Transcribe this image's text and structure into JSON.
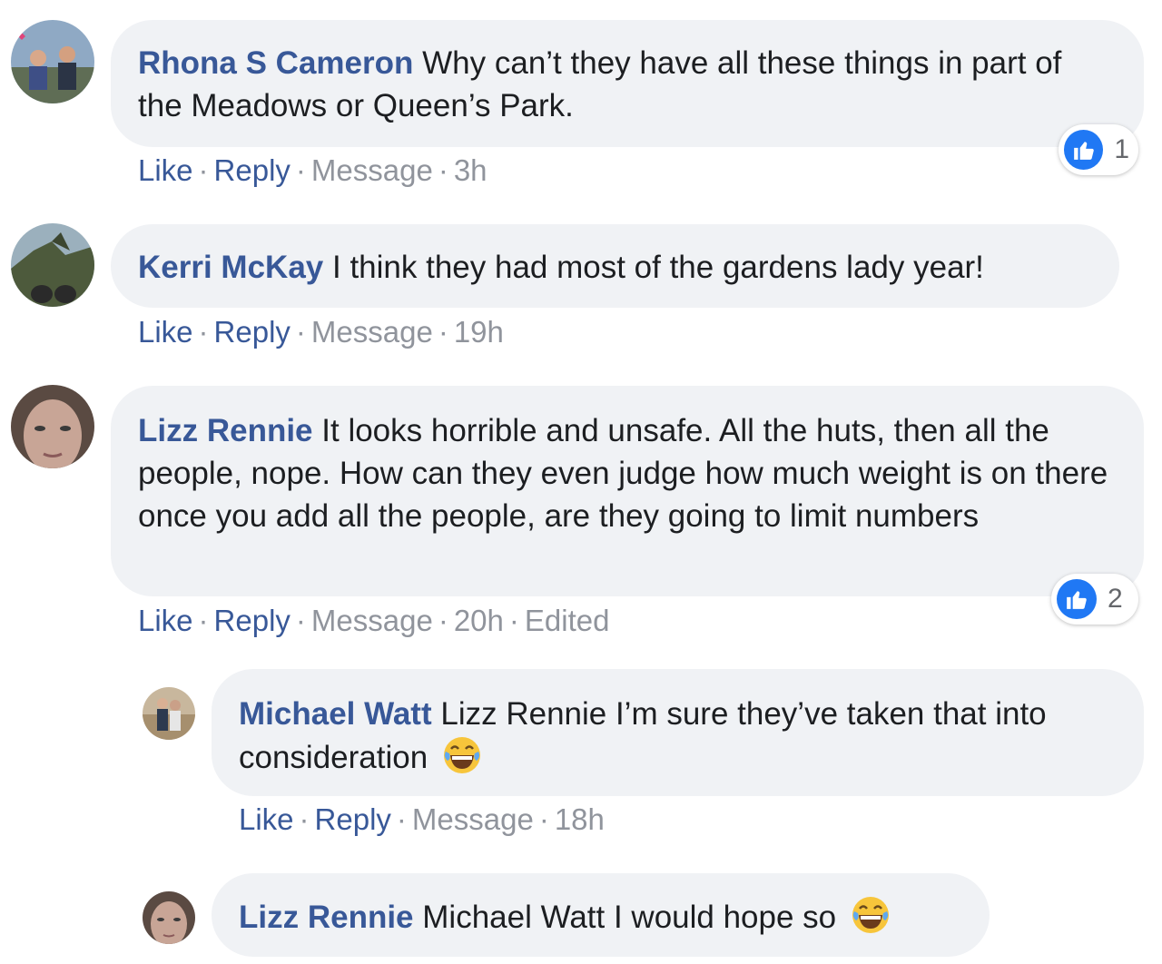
{
  "actions": {
    "like": "Like",
    "reply": "Reply",
    "message": "Message",
    "separator": "·"
  },
  "colors": {
    "author": "#385898",
    "bubble": "#f0f2f5",
    "like_blue": "#2078f4",
    "meta_grey": "#90949c"
  },
  "comments": [
    {
      "author": "Rhona S Cameron",
      "text": "Why can’t they have all these things in part of the Meadows or Queen’s Park.",
      "time": "3h",
      "reaction_icon": "like-icon",
      "reaction_count": "1"
    },
    {
      "author": "Kerri McKay",
      "text": "I think they had most of the gardens lady year!",
      "time": "19h"
    },
    {
      "author": "Lizz Rennie",
      "text": "It looks horrible and unsafe. All the huts, then all the people, nope. How can they even judge how much weight is on there once you add all the people, are they going to limit numbers",
      "time": "20h",
      "edited": "Edited",
      "reaction_icon": "like-icon",
      "reaction_count": "2"
    },
    {
      "author": "Michael Watt",
      "text": "Lizz Rennie I’m sure they’ve taken that into consideration",
      "emoji": "laughing-tears-emoji",
      "time": "18h"
    },
    {
      "author": "Lizz Rennie",
      "text": "Michael Watt I would hope so",
      "emoji": "laughing-tears-emoji"
    }
  ]
}
